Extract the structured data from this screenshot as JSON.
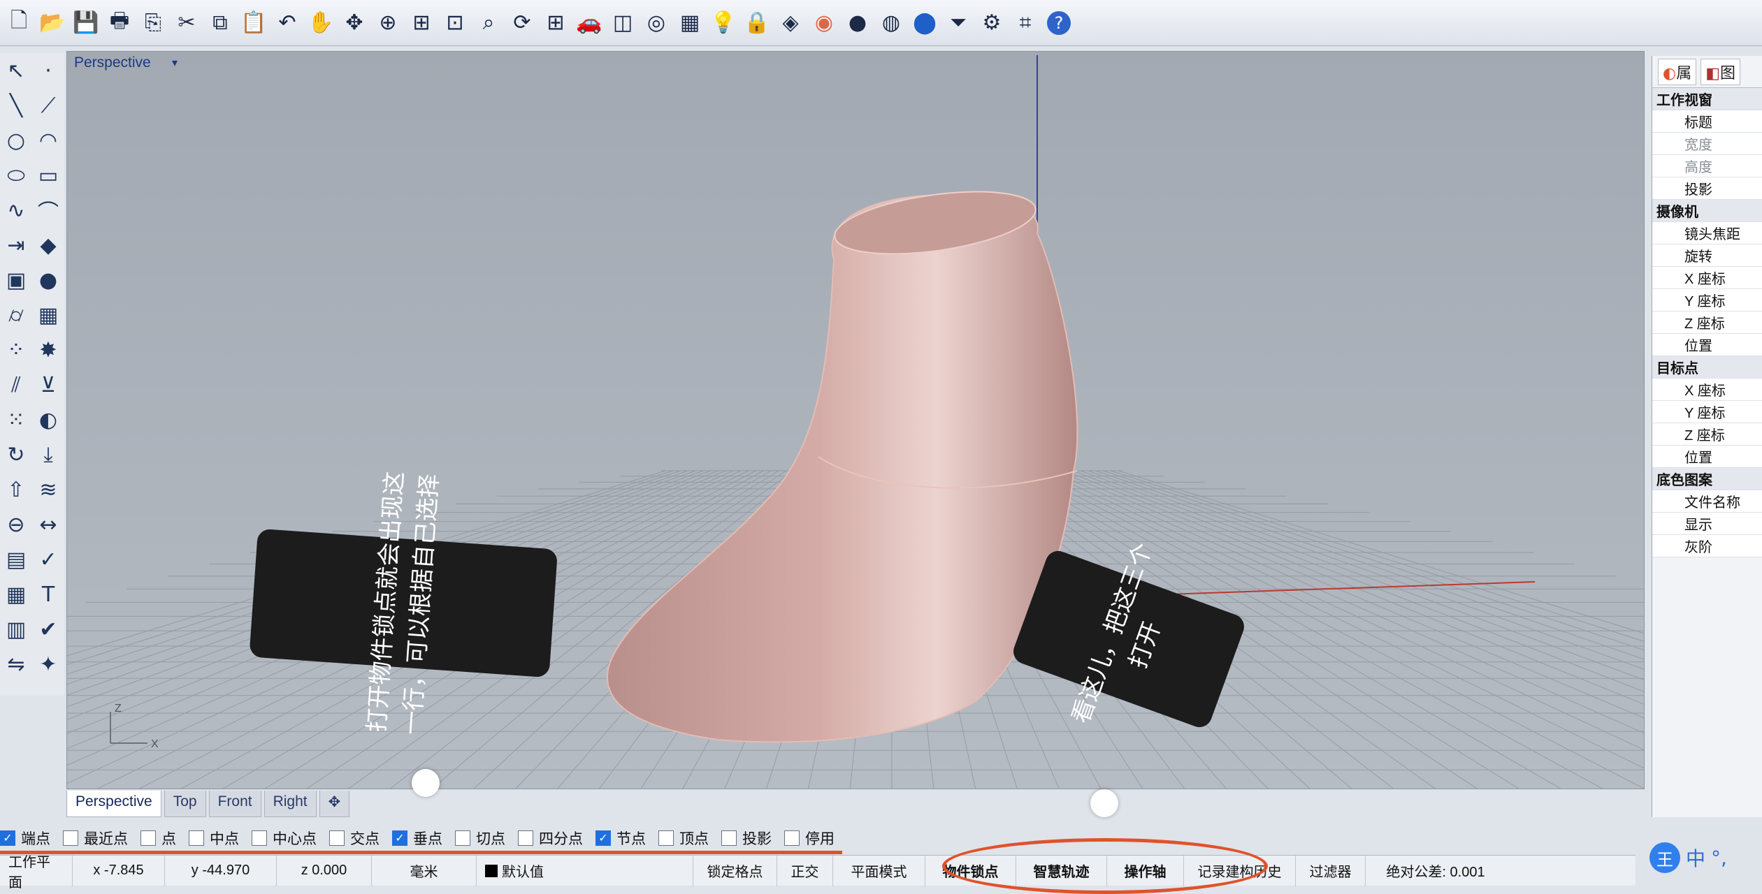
{
  "toolbar": {
    "icons": [
      "new-file-icon",
      "open-folder-icon",
      "save-icon",
      "print-icon",
      "import-icon",
      "cut-icon",
      "copy-icon",
      "paste-icon",
      "undo-icon",
      "pan-hand-icon",
      "move-icon",
      "zoom-icon",
      "zoom-window-icon",
      "zoom-extents-icon",
      "zoom-selected-icon",
      "rotate-view-icon",
      "four-viewports-icon",
      "car-icon",
      "layer-icon",
      "osnap-icon",
      "grid-icon",
      "light-icon",
      "lock-icon",
      "material-icon",
      "color-wheel-icon",
      "shaded-sphere-icon",
      "rendered-sphere-icon",
      "blue-sphere-icon",
      "filter-icon",
      "gear-icon",
      "curve-tools-icon",
      "help-icon"
    ]
  },
  "left_tools": {
    "icons": [
      "select-arrow-icon",
      "point-icon",
      "line-icon",
      "polyline-icon",
      "circle-icon",
      "arc-icon",
      "ellipse-icon",
      "rectangle-icon",
      "curve-icon",
      "fillet-icon",
      "extend-icon",
      "surface-icon",
      "solid-box-icon",
      "sphere-icon",
      "cylinder-icon",
      "mesh-icon",
      "edit-points-icon",
      "explode-icon",
      "split-icon",
      "join-icon",
      "array-icon",
      "analyze-icon",
      "rebuild-icon",
      "project-icon",
      "extrude-icon",
      "loft-icon",
      "boolean-icon",
      "dimension-icon",
      "block-icon",
      "check-icon",
      "grid-array-icon",
      "text-icon",
      "layout-icon",
      "confirm-icon",
      "flip-icon",
      "render-icon"
    ]
  },
  "viewport": {
    "title": "Perspective",
    "tabs": [
      "Perspective",
      "Top",
      "Front",
      "Right"
    ],
    "active_tab": "Perspective",
    "axis_labels": {
      "z": "Z",
      "x": "X"
    }
  },
  "annotations": [
    {
      "text_line1": "打开物件锁点就会出现这",
      "text_line2": "一行，可以根据自己选择"
    },
    {
      "text_line1": "看这儿，把这三个",
      "text_line2": "打开"
    }
  ],
  "osnap": [
    {
      "label": "端点",
      "checked": true
    },
    {
      "label": "最近点",
      "checked": false
    },
    {
      "label": "点",
      "checked": false
    },
    {
      "label": "中点",
      "checked": false
    },
    {
      "label": "中心点",
      "checked": false
    },
    {
      "label": "交点",
      "checked": false
    },
    {
      "label": "垂点",
      "checked": true
    },
    {
      "label": "切点",
      "checked": false
    },
    {
      "label": "四分点",
      "checked": false
    },
    {
      "label": "节点",
      "checked": true
    },
    {
      "label": "顶点",
      "checked": false
    },
    {
      "label": "投影",
      "checked": false
    },
    {
      "label": "停用",
      "checked": false
    }
  ],
  "status": {
    "cplane": "工作平面",
    "x": "x -7.845",
    "y": "y -44.970",
    "z": "z 0.000",
    "units": "毫米",
    "layer": "默认值",
    "grid_snap": "锁定格点",
    "ortho": "正交",
    "planar": "平面模式",
    "osnap": "物件锁点",
    "smarttrack": "智慧轨迹",
    "gumball": "操作轴",
    "history": "记录建构历史",
    "filter": "过滤器",
    "tolerance": "绝对公差: 0.001"
  },
  "panel": {
    "tab1": "属",
    "tab2": "图",
    "rows": [
      {
        "label": "工作视窗",
        "type": "section"
      },
      {
        "label": "标题",
        "type": "item"
      },
      {
        "label": "宽度",
        "type": "dim"
      },
      {
        "label": "高度",
        "type": "dim"
      },
      {
        "label": "投影",
        "type": "item"
      },
      {
        "label": "摄像机",
        "type": "section"
      },
      {
        "label": "镜头焦距",
        "type": "item"
      },
      {
        "label": "旋转",
        "type": "item"
      },
      {
        "label": "X 座标",
        "type": "item"
      },
      {
        "label": "Y 座标",
        "type": "item"
      },
      {
        "label": "Z 座标",
        "type": "item"
      },
      {
        "label": "位置",
        "type": "item"
      },
      {
        "label": "目标点",
        "type": "section"
      },
      {
        "label": "X 座标",
        "type": "item"
      },
      {
        "label": "Y 座标",
        "type": "item"
      },
      {
        "label": "Z 座标",
        "type": "item"
      },
      {
        "label": "位置",
        "type": "item"
      },
      {
        "label": "底色图案",
        "type": "section"
      },
      {
        "label": "文件名称",
        "type": "item"
      },
      {
        "label": "显示",
        "type": "item"
      },
      {
        "label": "灰阶",
        "type": "item"
      }
    ]
  },
  "ime": {
    "badge": "王",
    "mode": "中",
    "extra": "°,"
  },
  "colors": {
    "accent": "#1f6fe0",
    "highlight": "#e0522a",
    "shape": "#d9b3ad"
  }
}
